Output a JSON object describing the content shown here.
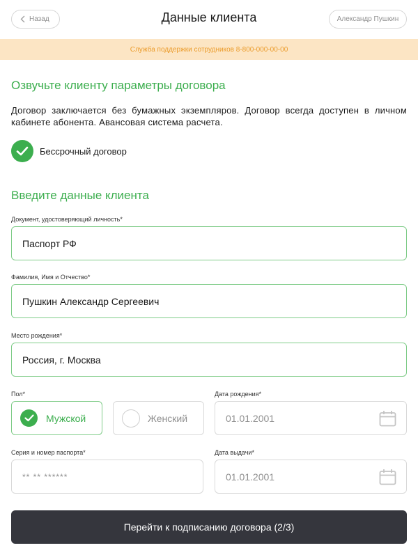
{
  "header": {
    "back_label": "Назад",
    "title": "Данные клиента",
    "user_name": "Александр Пушкин"
  },
  "support_banner": "Служба поддержки сотрудников 8-800-000-00-00",
  "contract": {
    "title": "Озвучьте клиенту параметры договора",
    "text": "Договор заключается без бумажных экземпляров. Договор всегда доступен в личном кабинете абонента. Авансовая система расчета.",
    "perpetual_label": "Бессрочный договор"
  },
  "client": {
    "title": "Введите данные клиента",
    "document_label": "Документ, удостоверяющий личность*",
    "document_value": "Паспорт РФ",
    "fio_label": "Фамилия, Имя и Отчество*",
    "fio_value": "Пушкин Александр Сергеевич",
    "birthplace_label": "Место рождения*",
    "birthplace_value": "Россия, г. Москва",
    "gender_label": "Пол*",
    "gender_male": "Мужской",
    "gender_female": "Женский",
    "gender_selected": "Мужской",
    "birthdate_label": "Дата рождения*",
    "birthdate_value": "01.01.2001",
    "passport_label": "Серия и номер паспорта*",
    "passport_placeholder": "** ** ******",
    "issue_date_label": "Дата выдачи*",
    "issue_date_value": "01.01.2001"
  },
  "submit_label": "Перейти к подписанию договора (2/3)",
  "colors": {
    "accent": "#3cae4e",
    "banner_bg": "#fce5c4",
    "banner_text": "#eb9c2c",
    "button_bg": "#35363d"
  },
  "icons": {
    "back": "chevron-left-icon",
    "check": "check-icon",
    "calendar": "calendar-icon"
  }
}
